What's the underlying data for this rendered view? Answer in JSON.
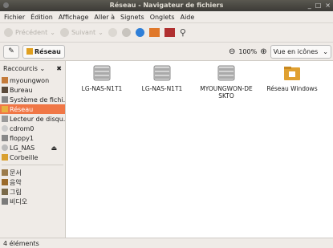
{
  "window": {
    "title": "Réseau - Navigateur de fichiers",
    "ctrl_min": "_",
    "ctrl_max": "□",
    "ctrl_close": "×"
  },
  "menu": [
    "Fichier",
    "Édition",
    "Affichage",
    "Aller à",
    "Signets",
    "Onglets",
    "Aide"
  ],
  "toolbar": {
    "back": "Précédent",
    "forward": "Suivant"
  },
  "location": {
    "crumb": "Réseau",
    "zoom": "100%",
    "view": "Vue en icônes"
  },
  "sidebar": {
    "header": "Raccourcis",
    "places": [
      {
        "label": "myoungwon",
        "icon": "home-icon",
        "color": "#c47b3a"
      },
      {
        "label": "Bureau",
        "icon": "desktop-icon",
        "color": "#5a4a3a"
      },
      {
        "label": "Système de fichi...",
        "icon": "filesystem-icon",
        "color": "#888"
      },
      {
        "label": "Réseau",
        "icon": "network-icon",
        "color": "#e0a020",
        "selected": true
      },
      {
        "label": "Lecteur de disqu...",
        "icon": "drive-icon",
        "color": "#999"
      },
      {
        "label": "cdrom0",
        "icon": "cdrom-icon",
        "color": "#aaa"
      },
      {
        "label": "floppy1",
        "icon": "floppy-icon",
        "color": "#888"
      },
      {
        "label": "LG_NAS",
        "icon": "network-drive-icon",
        "color": "#aaa"
      },
      {
        "label": "Corbeille",
        "icon": "trash-icon",
        "color": "#d9a030"
      }
    ],
    "bookmarks": [
      {
        "label": "문서",
        "icon": "documents-folder-icon",
        "color": "#9b7b4b"
      },
      {
        "label": "음악",
        "icon": "music-folder-icon",
        "color": "#9b6b2b"
      },
      {
        "label": "그림",
        "icon": "pictures-folder-icon",
        "color": "#7b6b4b"
      },
      {
        "label": "비디오",
        "icon": "videos-folder-icon",
        "color": "#7b7b7b"
      }
    ]
  },
  "files": [
    {
      "label": "LG-NAS-N1T1",
      "icon": "server-icon"
    },
    {
      "label": "LG-NAS-N1T1",
      "icon": "server-icon"
    },
    {
      "label": "MYOUNGWON-DESKTO",
      "icon": "server-icon"
    },
    {
      "label": "Réseau Windows",
      "icon": "windows-network-folder-icon"
    }
  ],
  "status": "4 éléments"
}
